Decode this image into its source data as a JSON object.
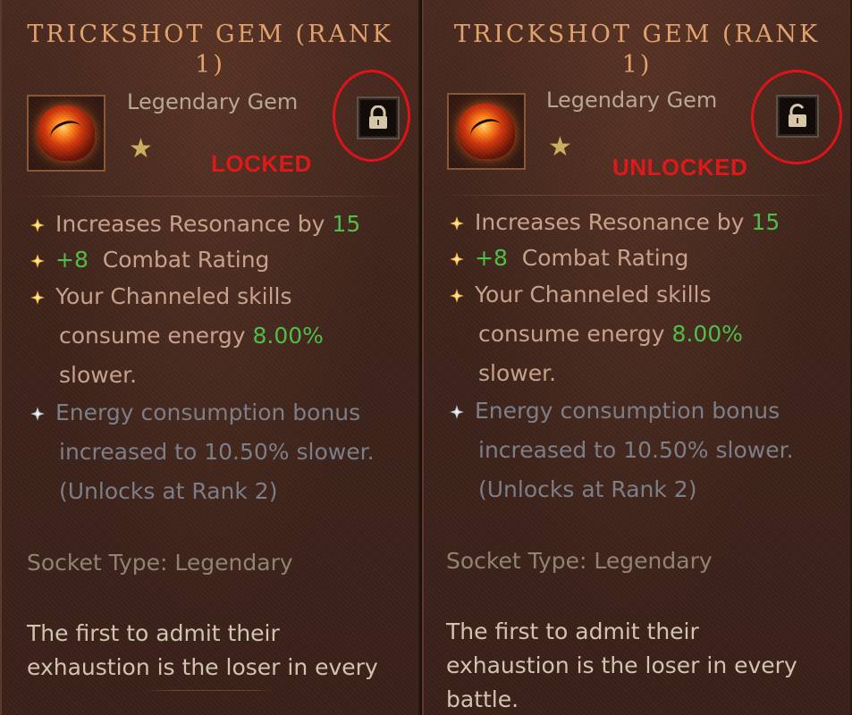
{
  "panels": [
    {
      "title": "Trickshot Gem (Rank 1)",
      "subtype": "Legendary Gem",
      "stars": "★",
      "lock_state": "locked",
      "status_label": "LOCKED",
      "affix1_text": "Increases Resonance by ",
      "affix1_value": "15",
      "affix2_value": "+8",
      "affix2_text": "Combat Rating",
      "affix3_line1": "Your Channeled skills",
      "affix3_line2": "consume energy ",
      "affix3_value": "8.00%",
      "affix3_line3": "slower.",
      "rank_line1": "Energy consumption bonus",
      "rank_line2": "increased to 10.50% slower.",
      "rank_line3": "(Unlocks at Rank 2)",
      "socket_type": "Socket Type: Legendary",
      "flavor_line1": "The first to admit their",
      "flavor_line2": "exhaustion is the loser in every"
    },
    {
      "title": "Trickshot Gem (Rank 1)",
      "subtype": "Legendary Gem",
      "stars": "★",
      "lock_state": "unlocked",
      "status_label": "UNLOCKED",
      "affix1_text": "Increases Resonance by ",
      "affix1_value": "15",
      "affix2_value": "+8",
      "affix2_text": "Combat Rating",
      "affix3_line1": "Your Channeled skills",
      "affix3_line2": "consume energy ",
      "affix3_value": "8.00%",
      "affix3_line3": "slower.",
      "rank_line1": "Energy consumption bonus",
      "rank_line2": "increased to 10.50% slower.",
      "rank_line3": "(Unlocks at Rank 2)",
      "socket_type": "Socket Type: Legendary",
      "flavor_line1": "The first to admit their",
      "flavor_line2": "exhaustion is the loser in every",
      "flavor_line3": "battle."
    }
  ],
  "icons": {
    "gem": "gem-icon",
    "star": "star-icon",
    "locked": "padlock-closed-icon",
    "unlocked": "padlock-open-icon",
    "affix_bullet": "diamond-bullet-icon",
    "rank_bullet": "grey-diamond-bullet-icon"
  },
  "colors": {
    "title": "#e4a46c",
    "affix_text": "#c9a38c",
    "affix_value": "#4fc048",
    "muted": "#7e7f88",
    "annotation_red": "#e0121a"
  }
}
